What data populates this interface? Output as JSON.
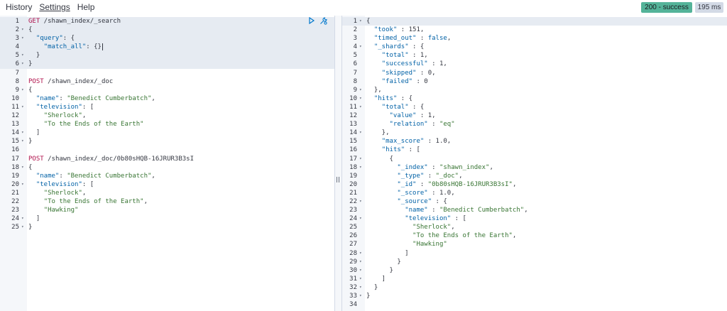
{
  "menu": {
    "history": "History",
    "settings": "Settings",
    "help": "Help"
  },
  "status": {
    "badge": "200 - success",
    "time": "195 ms"
  },
  "request": {
    "lines": [
      [
        [
          "GET",
          "method"
        ],
        [
          " /shawn_index/_search",
          "url"
        ]
      ],
      [
        [
          "{",
          "p"
        ]
      ],
      [
        [
          "  ",
          "p"
        ],
        [
          "\"query\"",
          "key"
        ],
        [
          ": {",
          "p"
        ]
      ],
      [
        [
          "    ",
          "p"
        ],
        [
          "\"match_all\"",
          "key"
        ],
        [
          ": {}",
          "p"
        ]
      ],
      [
        [
          "  }",
          "p"
        ]
      ],
      [
        [
          "}",
          "p"
        ]
      ],
      [],
      [
        [
          "POST",
          "method"
        ],
        [
          " /shawn_index/_doc",
          "url"
        ]
      ],
      [
        [
          "{",
          "p"
        ]
      ],
      [
        [
          "  ",
          "p"
        ],
        [
          "\"name\"",
          "key"
        ],
        [
          ": ",
          "p"
        ],
        [
          "\"Benedict Cumberbatch\"",
          "str"
        ],
        [
          ",",
          "p"
        ]
      ],
      [
        [
          "  ",
          "p"
        ],
        [
          "\"television\"",
          "key"
        ],
        [
          ": [",
          "p"
        ]
      ],
      [
        [
          "    ",
          "p"
        ],
        [
          "\"Sherlock\"",
          "str"
        ],
        [
          ",",
          "p"
        ]
      ],
      [
        [
          "    ",
          "p"
        ],
        [
          "\"To the Ends of the Earth\"",
          "str"
        ]
      ],
      [
        [
          "  ]",
          "p"
        ]
      ],
      [
        [
          "}",
          "p"
        ]
      ],
      [],
      [
        [
          "POST",
          "method"
        ],
        [
          " /shawn_index/_doc/0b80sHQB-16JRUR3B3sI",
          "url"
        ]
      ],
      [
        [
          "{",
          "p"
        ]
      ],
      [
        [
          "  ",
          "p"
        ],
        [
          "\"name\"",
          "key"
        ],
        [
          ": ",
          "p"
        ],
        [
          "\"Benedict Cumberbatch\"",
          "str"
        ],
        [
          ",",
          "p"
        ]
      ],
      [
        [
          "  ",
          "p"
        ],
        [
          "\"television\"",
          "key"
        ],
        [
          ": [",
          "p"
        ]
      ],
      [
        [
          "    ",
          "p"
        ],
        [
          "\"Sherlock\"",
          "str"
        ],
        [
          ",",
          "p"
        ]
      ],
      [
        [
          "    ",
          "p"
        ],
        [
          "\"To the Ends of the Earth\"",
          "str"
        ],
        [
          ",",
          "p"
        ]
      ],
      [
        [
          "    ",
          "p"
        ],
        [
          "\"Hawking\"",
          "str"
        ]
      ],
      [
        [
          "  ]",
          "p"
        ]
      ],
      [
        [
          "}",
          "p"
        ]
      ]
    ],
    "folds": [
      2,
      3,
      5,
      6,
      9,
      11,
      14,
      15,
      18,
      20,
      24,
      25
    ],
    "highlighted_block": [
      1,
      6
    ],
    "cursor_line": 4
  },
  "response": {
    "lines": [
      [
        [
          "{",
          "p"
        ]
      ],
      [
        [
          "  ",
          "p"
        ],
        [
          "\"took\"",
          "key"
        ],
        [
          " : 151,",
          "p"
        ]
      ],
      [
        [
          "  ",
          "p"
        ],
        [
          "\"timed_out\"",
          "key"
        ],
        [
          " : ",
          "p"
        ],
        [
          "false",
          "kw"
        ],
        [
          ",",
          "p"
        ]
      ],
      [
        [
          "  ",
          "p"
        ],
        [
          "\"_shards\"",
          "key"
        ],
        [
          " : {",
          "p"
        ]
      ],
      [
        [
          "    ",
          "p"
        ],
        [
          "\"total\"",
          "key"
        ],
        [
          " : 1,",
          "p"
        ]
      ],
      [
        [
          "    ",
          "p"
        ],
        [
          "\"successful\"",
          "key"
        ],
        [
          " : 1,",
          "p"
        ]
      ],
      [
        [
          "    ",
          "p"
        ],
        [
          "\"skipped\"",
          "key"
        ],
        [
          " : 0,",
          "p"
        ]
      ],
      [
        [
          "    ",
          "p"
        ],
        [
          "\"failed\"",
          "key"
        ],
        [
          " : 0",
          "p"
        ]
      ],
      [
        [
          "  },",
          "p"
        ]
      ],
      [
        [
          "  ",
          "p"
        ],
        [
          "\"hits\"",
          "key"
        ],
        [
          " : {",
          "p"
        ]
      ],
      [
        [
          "    ",
          "p"
        ],
        [
          "\"total\"",
          "key"
        ],
        [
          " : {",
          "p"
        ]
      ],
      [
        [
          "      ",
          "p"
        ],
        [
          "\"value\"",
          "key"
        ],
        [
          " : 1,",
          "p"
        ]
      ],
      [
        [
          "      ",
          "p"
        ],
        [
          "\"relation\"",
          "key"
        ],
        [
          " : ",
          "p"
        ],
        [
          "\"eq\"",
          "str"
        ]
      ],
      [
        [
          "    },",
          "p"
        ]
      ],
      [
        [
          "    ",
          "p"
        ],
        [
          "\"max_score\"",
          "key"
        ],
        [
          " : 1.0,",
          "p"
        ]
      ],
      [
        [
          "    ",
          "p"
        ],
        [
          "\"hits\"",
          "key"
        ],
        [
          " : [",
          "p"
        ]
      ],
      [
        [
          "      {",
          "p"
        ]
      ],
      [
        [
          "        ",
          "p"
        ],
        [
          "\"_index\"",
          "key"
        ],
        [
          " : ",
          "p"
        ],
        [
          "\"shawn_index\"",
          "str"
        ],
        [
          ",",
          "p"
        ]
      ],
      [
        [
          "        ",
          "p"
        ],
        [
          "\"_type\"",
          "key"
        ],
        [
          " : ",
          "p"
        ],
        [
          "\"_doc\"",
          "str"
        ],
        [
          ",",
          "p"
        ]
      ],
      [
        [
          "        ",
          "p"
        ],
        [
          "\"_id\"",
          "key"
        ],
        [
          " : ",
          "p"
        ],
        [
          "\"0b80sHQB-16JRUR3B3sI\"",
          "str"
        ],
        [
          ",",
          "p"
        ]
      ],
      [
        [
          "        ",
          "p"
        ],
        [
          "\"_score\"",
          "key"
        ],
        [
          " : 1.0,",
          "p"
        ]
      ],
      [
        [
          "        ",
          "p"
        ],
        [
          "\"_source\"",
          "key"
        ],
        [
          " : {",
          "p"
        ]
      ],
      [
        [
          "          ",
          "p"
        ],
        [
          "\"name\"",
          "key"
        ],
        [
          " : ",
          "p"
        ],
        [
          "\"Benedict Cumberbatch\"",
          "str"
        ],
        [
          ",",
          "p"
        ]
      ],
      [
        [
          "          ",
          "p"
        ],
        [
          "\"television\"",
          "key"
        ],
        [
          " : [",
          "p"
        ]
      ],
      [
        [
          "            ",
          "p"
        ],
        [
          "\"Sherlock\"",
          "str"
        ],
        [
          ",",
          "p"
        ]
      ],
      [
        [
          "            ",
          "p"
        ],
        [
          "\"To the Ends of the Earth\"",
          "str"
        ],
        [
          ",",
          "p"
        ]
      ],
      [
        [
          "            ",
          "p"
        ],
        [
          "\"Hawking\"",
          "str"
        ]
      ],
      [
        [
          "          ]",
          "p"
        ]
      ],
      [
        [
          "        }",
          "p"
        ]
      ],
      [
        [
          "      }",
          "p"
        ]
      ],
      [
        [
          "    ]",
          "p"
        ]
      ],
      [
        [
          "  }",
          "p"
        ]
      ],
      [
        [
          "}",
          "p"
        ]
      ],
      []
    ],
    "folds": [
      1,
      4,
      9,
      10,
      11,
      14,
      17,
      18,
      22,
      24,
      28,
      29,
      30,
      31,
      32,
      33
    ],
    "highlighted_line": 1
  },
  "icons": {
    "run": "play-icon",
    "settings": "wrench-icon"
  }
}
